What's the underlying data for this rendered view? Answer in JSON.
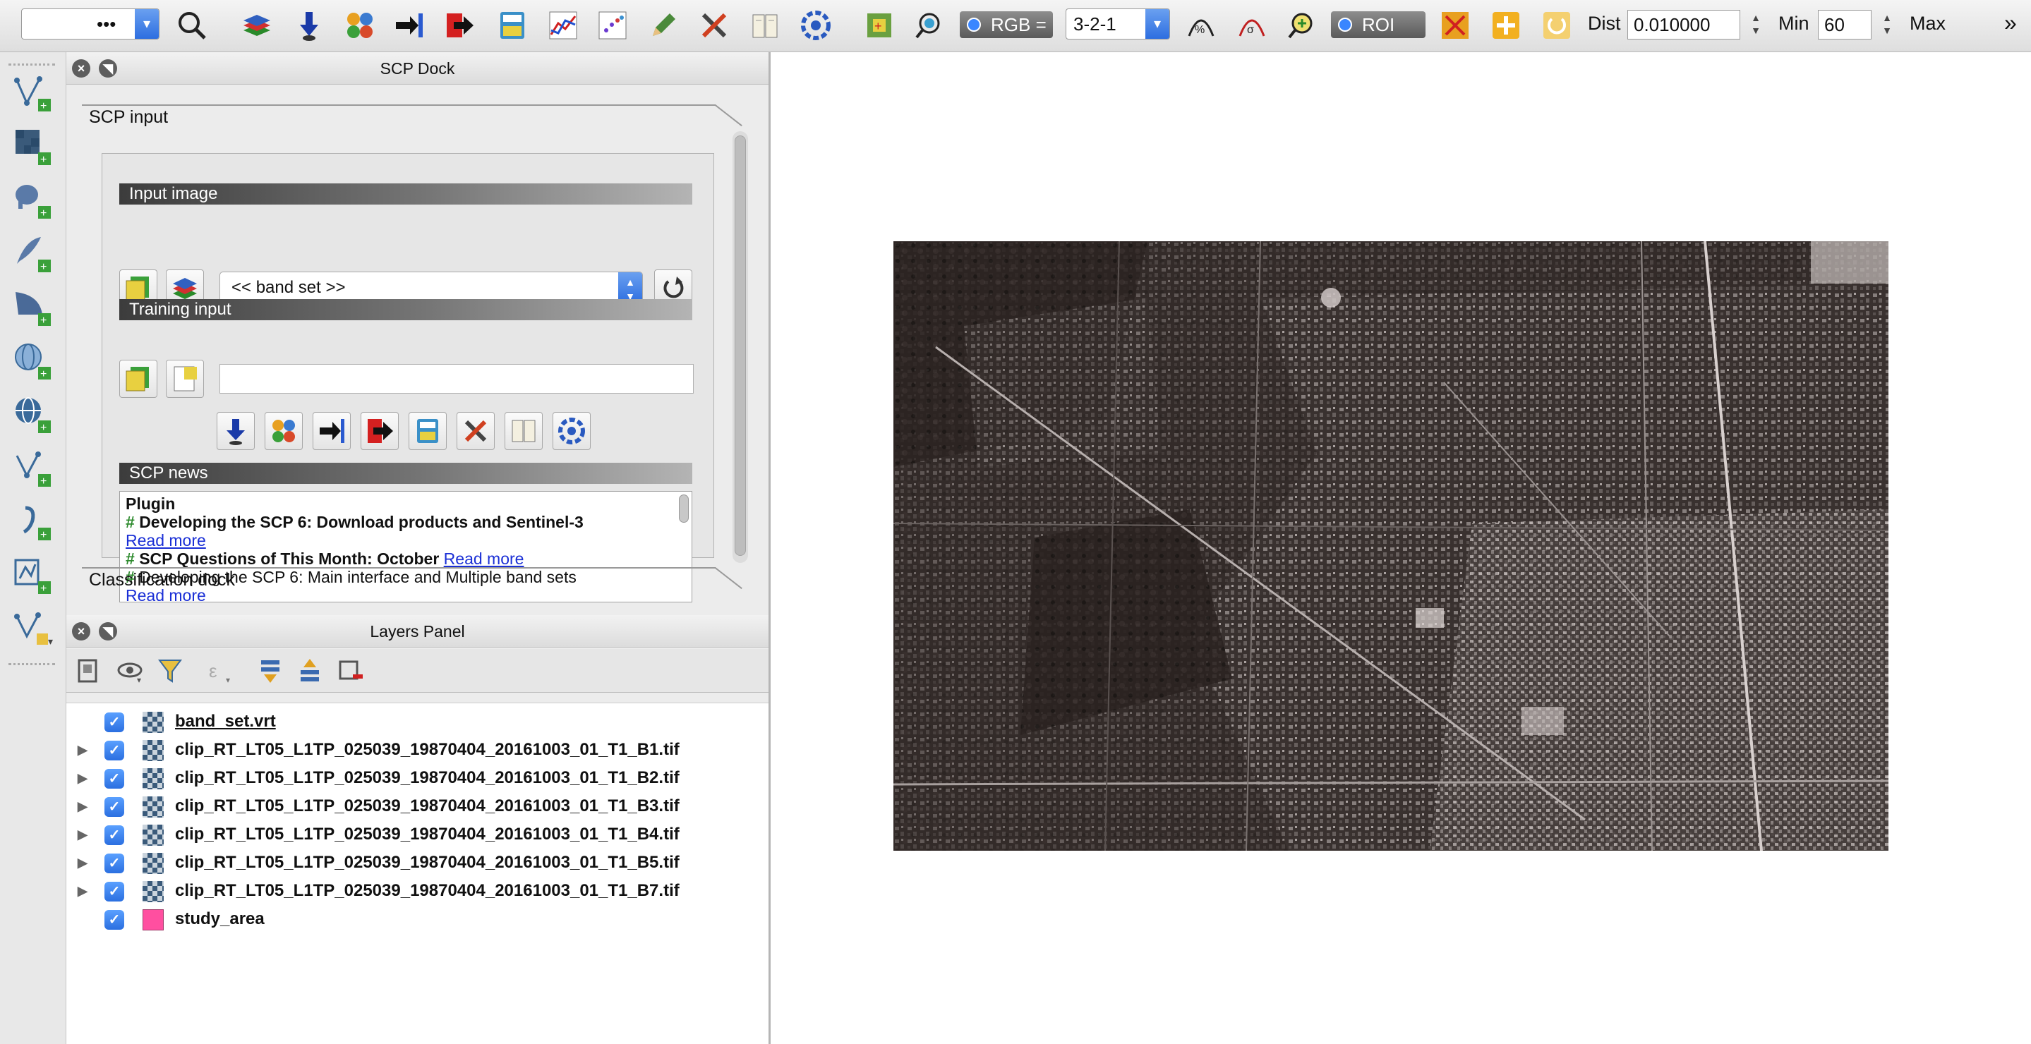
{
  "toolbar": {
    "first_combo_value": "•••",
    "rgb_label": "RGB =",
    "rgb_value": "3-2-1",
    "roi_label": "ROI",
    "dist_label": "Dist",
    "dist_value": "0.010000",
    "min_label": "Min",
    "min_value": "60",
    "max_label": "Max",
    "overflow_glyph": "»"
  },
  "scp_dock": {
    "title": "SCP Dock",
    "tab_input": "SCP input",
    "tab_classification": "Classification dock",
    "input_image_header": "Input image",
    "band_set_value": "<< band set >>",
    "training_input_header": "Training input",
    "training_input_value": "",
    "news_header": "SCP news",
    "news": {
      "line1": "Plugin",
      "hash": "#",
      "item1_title": "Developing the SCP 6: Download products and Sentinel-3",
      "item1_link": "Read more",
      "item2_title": "SCP Questions of This Month: October",
      "item2_link": "Read more",
      "item3_title": "Developing the SCP 6: Main interface and Multiple band sets",
      "item3_link": "Read more"
    }
  },
  "layers_panel": {
    "title": "Layers Panel",
    "check_glyph": "✓",
    "expand_glyph": "▶",
    "layers": [
      {
        "name": "band_set.vrt"
      },
      {
        "name": "clip_RT_LT05_L1TP_025039_19870404_20161003_01_T1_B1.tif"
      },
      {
        "name": "clip_RT_LT05_L1TP_025039_19870404_20161003_01_T1_B2.tif"
      },
      {
        "name": "clip_RT_LT05_L1TP_025039_19870404_20161003_01_T1_B3.tif"
      },
      {
        "name": "clip_RT_LT05_L1TP_025039_19870404_20161003_01_T1_B4.tif"
      },
      {
        "name": "clip_RT_LT05_L1TP_025039_19870404_20161003_01_T1_B5.tif"
      },
      {
        "name": "clip_RT_LT05_L1TP_025039_19870404_20161003_01_T1_B7.tif"
      },
      {
        "name": "study_area"
      }
    ]
  },
  "colors": {
    "accent_blue": "#2d6ee0",
    "study_area_fill": "#ff4fa0",
    "link": "#1a2fd6",
    "news_hash": "#2e8b2e"
  }
}
